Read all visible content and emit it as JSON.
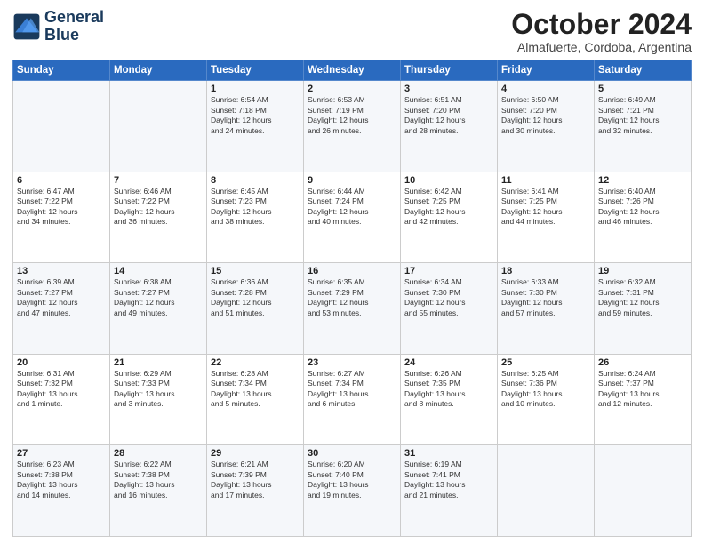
{
  "logo": {
    "line1": "General",
    "line2": "Blue"
  },
  "title": "October 2024",
  "location": "Almafuerte, Cordoba, Argentina",
  "days_of_week": [
    "Sunday",
    "Monday",
    "Tuesday",
    "Wednesday",
    "Thursday",
    "Friday",
    "Saturday"
  ],
  "weeks": [
    [
      {
        "day": "",
        "info": ""
      },
      {
        "day": "",
        "info": ""
      },
      {
        "day": "1",
        "info": "Sunrise: 6:54 AM\nSunset: 7:18 PM\nDaylight: 12 hours\nand 24 minutes."
      },
      {
        "day": "2",
        "info": "Sunrise: 6:53 AM\nSunset: 7:19 PM\nDaylight: 12 hours\nand 26 minutes."
      },
      {
        "day": "3",
        "info": "Sunrise: 6:51 AM\nSunset: 7:20 PM\nDaylight: 12 hours\nand 28 minutes."
      },
      {
        "day": "4",
        "info": "Sunrise: 6:50 AM\nSunset: 7:20 PM\nDaylight: 12 hours\nand 30 minutes."
      },
      {
        "day": "5",
        "info": "Sunrise: 6:49 AM\nSunset: 7:21 PM\nDaylight: 12 hours\nand 32 minutes."
      }
    ],
    [
      {
        "day": "6",
        "info": "Sunrise: 6:47 AM\nSunset: 7:22 PM\nDaylight: 12 hours\nand 34 minutes."
      },
      {
        "day": "7",
        "info": "Sunrise: 6:46 AM\nSunset: 7:22 PM\nDaylight: 12 hours\nand 36 minutes."
      },
      {
        "day": "8",
        "info": "Sunrise: 6:45 AM\nSunset: 7:23 PM\nDaylight: 12 hours\nand 38 minutes."
      },
      {
        "day": "9",
        "info": "Sunrise: 6:44 AM\nSunset: 7:24 PM\nDaylight: 12 hours\nand 40 minutes."
      },
      {
        "day": "10",
        "info": "Sunrise: 6:42 AM\nSunset: 7:25 PM\nDaylight: 12 hours\nand 42 minutes."
      },
      {
        "day": "11",
        "info": "Sunrise: 6:41 AM\nSunset: 7:25 PM\nDaylight: 12 hours\nand 44 minutes."
      },
      {
        "day": "12",
        "info": "Sunrise: 6:40 AM\nSunset: 7:26 PM\nDaylight: 12 hours\nand 46 minutes."
      }
    ],
    [
      {
        "day": "13",
        "info": "Sunrise: 6:39 AM\nSunset: 7:27 PM\nDaylight: 12 hours\nand 47 minutes."
      },
      {
        "day": "14",
        "info": "Sunrise: 6:38 AM\nSunset: 7:27 PM\nDaylight: 12 hours\nand 49 minutes."
      },
      {
        "day": "15",
        "info": "Sunrise: 6:36 AM\nSunset: 7:28 PM\nDaylight: 12 hours\nand 51 minutes."
      },
      {
        "day": "16",
        "info": "Sunrise: 6:35 AM\nSunset: 7:29 PM\nDaylight: 12 hours\nand 53 minutes."
      },
      {
        "day": "17",
        "info": "Sunrise: 6:34 AM\nSunset: 7:30 PM\nDaylight: 12 hours\nand 55 minutes."
      },
      {
        "day": "18",
        "info": "Sunrise: 6:33 AM\nSunset: 7:30 PM\nDaylight: 12 hours\nand 57 minutes."
      },
      {
        "day": "19",
        "info": "Sunrise: 6:32 AM\nSunset: 7:31 PM\nDaylight: 12 hours\nand 59 minutes."
      }
    ],
    [
      {
        "day": "20",
        "info": "Sunrise: 6:31 AM\nSunset: 7:32 PM\nDaylight: 13 hours\nand 1 minute."
      },
      {
        "day": "21",
        "info": "Sunrise: 6:29 AM\nSunset: 7:33 PM\nDaylight: 13 hours\nand 3 minutes."
      },
      {
        "day": "22",
        "info": "Sunrise: 6:28 AM\nSunset: 7:34 PM\nDaylight: 13 hours\nand 5 minutes."
      },
      {
        "day": "23",
        "info": "Sunrise: 6:27 AM\nSunset: 7:34 PM\nDaylight: 13 hours\nand 6 minutes."
      },
      {
        "day": "24",
        "info": "Sunrise: 6:26 AM\nSunset: 7:35 PM\nDaylight: 13 hours\nand 8 minutes."
      },
      {
        "day": "25",
        "info": "Sunrise: 6:25 AM\nSunset: 7:36 PM\nDaylight: 13 hours\nand 10 minutes."
      },
      {
        "day": "26",
        "info": "Sunrise: 6:24 AM\nSunset: 7:37 PM\nDaylight: 13 hours\nand 12 minutes."
      }
    ],
    [
      {
        "day": "27",
        "info": "Sunrise: 6:23 AM\nSunset: 7:38 PM\nDaylight: 13 hours\nand 14 minutes."
      },
      {
        "day": "28",
        "info": "Sunrise: 6:22 AM\nSunset: 7:38 PM\nDaylight: 13 hours\nand 16 minutes."
      },
      {
        "day": "29",
        "info": "Sunrise: 6:21 AM\nSunset: 7:39 PM\nDaylight: 13 hours\nand 17 minutes."
      },
      {
        "day": "30",
        "info": "Sunrise: 6:20 AM\nSunset: 7:40 PM\nDaylight: 13 hours\nand 19 minutes."
      },
      {
        "day": "31",
        "info": "Sunrise: 6:19 AM\nSunset: 7:41 PM\nDaylight: 13 hours\nand 21 minutes."
      },
      {
        "day": "",
        "info": ""
      },
      {
        "day": "",
        "info": ""
      }
    ]
  ]
}
